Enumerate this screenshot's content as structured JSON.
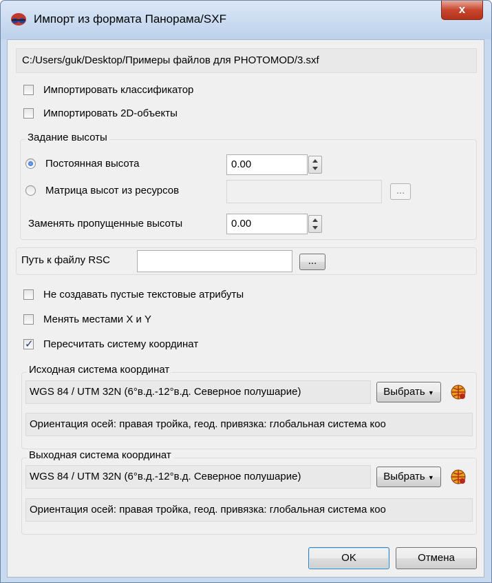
{
  "window": {
    "title": "Импорт из формата Панорама/SXF",
    "close_label": "x"
  },
  "file_path": "C:/Users/guk/Desktop/Примеры файлов для PHOTOMOD/3.sxf",
  "options": {
    "import_classifier": {
      "label": "Импортировать классификатор",
      "checked": false
    },
    "import_2d": {
      "label": "Импортировать 2D-объекты",
      "checked": false
    }
  },
  "height_group": {
    "title": "Задание высоты",
    "constant": {
      "label": "Постоянная высота",
      "value": "0.00",
      "selected": true
    },
    "matrix": {
      "label": "Матрица высот из ресурсов",
      "value": "",
      "selected": false,
      "browse_label": "..."
    },
    "replace_missing": {
      "label": "Заменять пропущенные высоты",
      "value": "0.00"
    }
  },
  "rsc": {
    "label": "Путь к файлу RSC",
    "value": "",
    "browse_label": "..."
  },
  "options2": {
    "no_empty_text": {
      "label": "Не создавать пустые текстовые атрибуты",
      "checked": false
    },
    "swap_xy": {
      "label": "Менять местами X и Y",
      "checked": false
    },
    "recalc_cs": {
      "label": "Пересчитать систему координат",
      "checked": true
    }
  },
  "source_cs": {
    "title": "Исходная система координат",
    "name": "WGS 84 / UTM 32N (6°в.д.-12°в.д. Северное полушарие)",
    "select_label": "Выбрать",
    "info": "Ориентация осей: правая тройка, геод. привязка: глобальная система коо"
  },
  "output_cs": {
    "title": "Выходная система координат",
    "name": "WGS 84 / UTM 32N (6°в.д.-12°в.д. Северное полушарие)",
    "select_label": "Выбрать",
    "info": "Ориентация осей: правая тройка, геод. привязка: глобальная система коо"
  },
  "footer": {
    "ok_label": "OK",
    "cancel_label": "Отмена"
  },
  "icons": {
    "app": "glasses-icon",
    "globe": "globe-icon"
  }
}
